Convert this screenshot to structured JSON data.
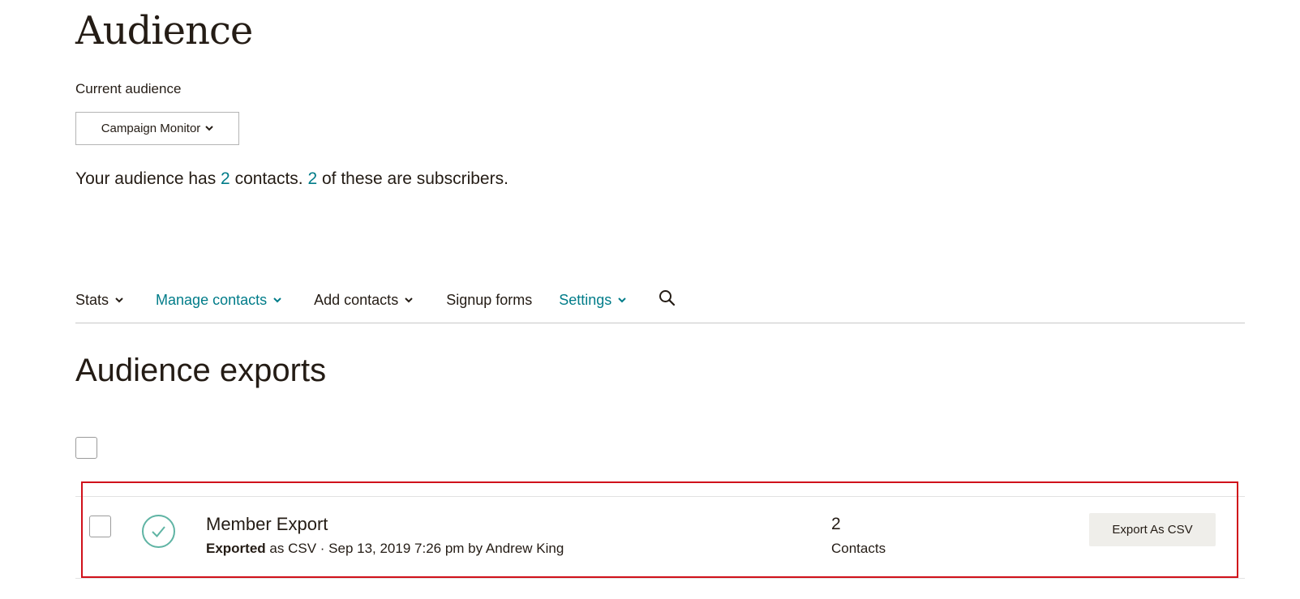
{
  "page": {
    "title": "Audience"
  },
  "audience": {
    "label": "Current audience",
    "selected": "Campaign Monitor"
  },
  "summary": {
    "part1": "Your audience has ",
    "contacts_count": "2",
    "part2": " contacts. ",
    "subscribers_count": "2",
    "part3": " of these are subscribers."
  },
  "nav": {
    "items": [
      {
        "label": "Stats",
        "dropdown": true,
        "color": "#241c15"
      },
      {
        "label": "Manage contacts",
        "dropdown": true,
        "color": "#007c89"
      },
      {
        "label": "Add contacts",
        "dropdown": true,
        "color": "#241c15"
      },
      {
        "label": "Signup forms",
        "dropdown": false,
        "color": "#241c15"
      },
      {
        "label": "Settings",
        "dropdown": true,
        "color": "#007c89"
      }
    ],
    "search_icon": "search-icon"
  },
  "exports": {
    "title": "Audience exports",
    "rows": [
      {
        "status_icon": "check-circle-icon",
        "name": "Member Export",
        "status": "Exported",
        "meta": " as CSV · Sep 13, 2019 7:26 pm by Andrew King",
        "count": "2",
        "count_label": "Contacts",
        "action_label": "Export As CSV"
      }
    ]
  },
  "colors": {
    "accent": "#007c89",
    "text": "#241c15",
    "success": "#5fb4a4",
    "highlight": "#d0111b",
    "button_bg": "#efeeea"
  }
}
